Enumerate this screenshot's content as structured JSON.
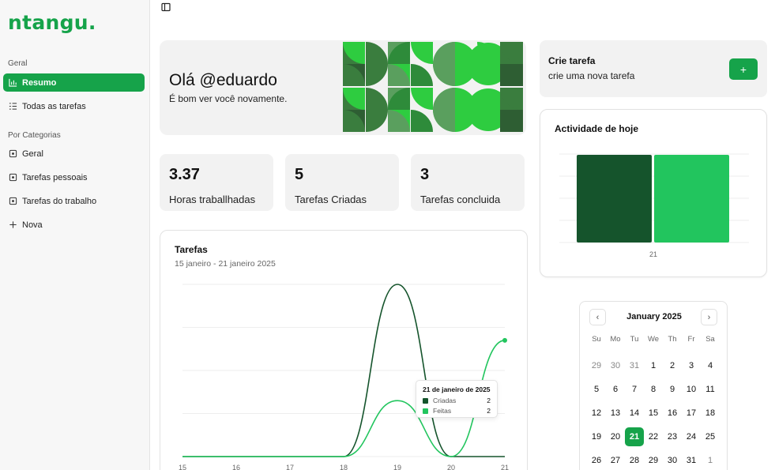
{
  "app": {
    "logo": "ntangu."
  },
  "sidebar": {
    "geral_label": "Geral",
    "items": [
      {
        "label": "Resumo",
        "icon": "bar-chart-icon",
        "active": true
      },
      {
        "label": "Todas as tarefas",
        "icon": "list-icon",
        "active": false
      }
    ],
    "categorias_label": "Por Categorias",
    "categories": [
      {
        "label": "Geral",
        "icon": "square-dot-icon"
      },
      {
        "label": "Tarefas pessoais",
        "icon": "square-dot-icon"
      },
      {
        "label": "Tarefas do trabalho",
        "icon": "square-dot-icon"
      },
      {
        "label": "Nova",
        "icon": "plus-icon"
      }
    ]
  },
  "hero": {
    "greeting": "Olá @eduardo",
    "subtitle": "É bom ver você novamente."
  },
  "stats": [
    {
      "value": "3.37",
      "label": "Horas traballhadas"
    },
    {
      "value": "5",
      "label": "Tarefas Criadas"
    },
    {
      "value": "3",
      "label": "Tarefas concluida"
    }
  ],
  "create_task": {
    "title": "Crie tarefa",
    "subtitle": "crie uma nova tarefa",
    "button": "+"
  },
  "activity": {
    "title": "Actividade de hoje",
    "x_label": "21",
    "bars": [
      {
        "name": "Criadas",
        "value": 2,
        "color": "#15542c"
      },
      {
        "name": "Feitas",
        "value": 2,
        "color": "#22c55e"
      }
    ]
  },
  "tasks_chart": {
    "title": "Tarefas",
    "subtitle": "15 janeiro - 21 janeiro 2025"
  },
  "chart_data": {
    "type": "line",
    "x": [
      "15",
      "16",
      "17",
      "18",
      "19",
      "20",
      "21"
    ],
    "series": [
      {
        "name": "Criadas",
        "color": "#15542c",
        "values": [
          0,
          0,
          0,
          0,
          4,
          0,
          0
        ]
      },
      {
        "name": "Feitas",
        "color": "#22c55e",
        "values": [
          0,
          0,
          0,
          0,
          1.3,
          0,
          2.7
        ]
      }
    ],
    "ylim": [
      0,
      4
    ],
    "grid": true,
    "tooltip": {
      "title": "21 de janeiro de 2025",
      "rows": [
        {
          "name": "Criadas",
          "value": "2",
          "color": "#15542c"
        },
        {
          "name": "Feitas",
          "value": "2",
          "color": "#22c55e"
        }
      ]
    }
  },
  "calendar": {
    "month_label": "January 2025",
    "weekdays": [
      "Su",
      "Mo",
      "Tu",
      "We",
      "Th",
      "Fr",
      "Sa"
    ],
    "selected": "21",
    "days": [
      {
        "d": "29",
        "out": true
      },
      {
        "d": "30",
        "out": true
      },
      {
        "d": "31",
        "out": true
      },
      {
        "d": "1"
      },
      {
        "d": "2"
      },
      {
        "d": "3"
      },
      {
        "d": "4"
      },
      {
        "d": "5"
      },
      {
        "d": "6"
      },
      {
        "d": "7"
      },
      {
        "d": "8"
      },
      {
        "d": "9"
      },
      {
        "d": "10"
      },
      {
        "d": "11"
      },
      {
        "d": "12"
      },
      {
        "d": "13"
      },
      {
        "d": "14"
      },
      {
        "d": "15"
      },
      {
        "d": "16"
      },
      {
        "d": "17"
      },
      {
        "d": "18"
      },
      {
        "d": "19"
      },
      {
        "d": "20"
      },
      {
        "d": "21"
      },
      {
        "d": "22"
      },
      {
        "d": "23"
      },
      {
        "d": "24"
      },
      {
        "d": "25"
      },
      {
        "d": "26"
      },
      {
        "d": "27"
      },
      {
        "d": "28"
      },
      {
        "d": "29"
      },
      {
        "d": "30"
      },
      {
        "d": "31"
      },
      {
        "d": "1",
        "out": true
      }
    ]
  },
  "colors": {
    "brand": "#16a34a",
    "dark_green": "#15542c",
    "light_green": "#22c55e",
    "card_bg": "#f2f2f2"
  }
}
